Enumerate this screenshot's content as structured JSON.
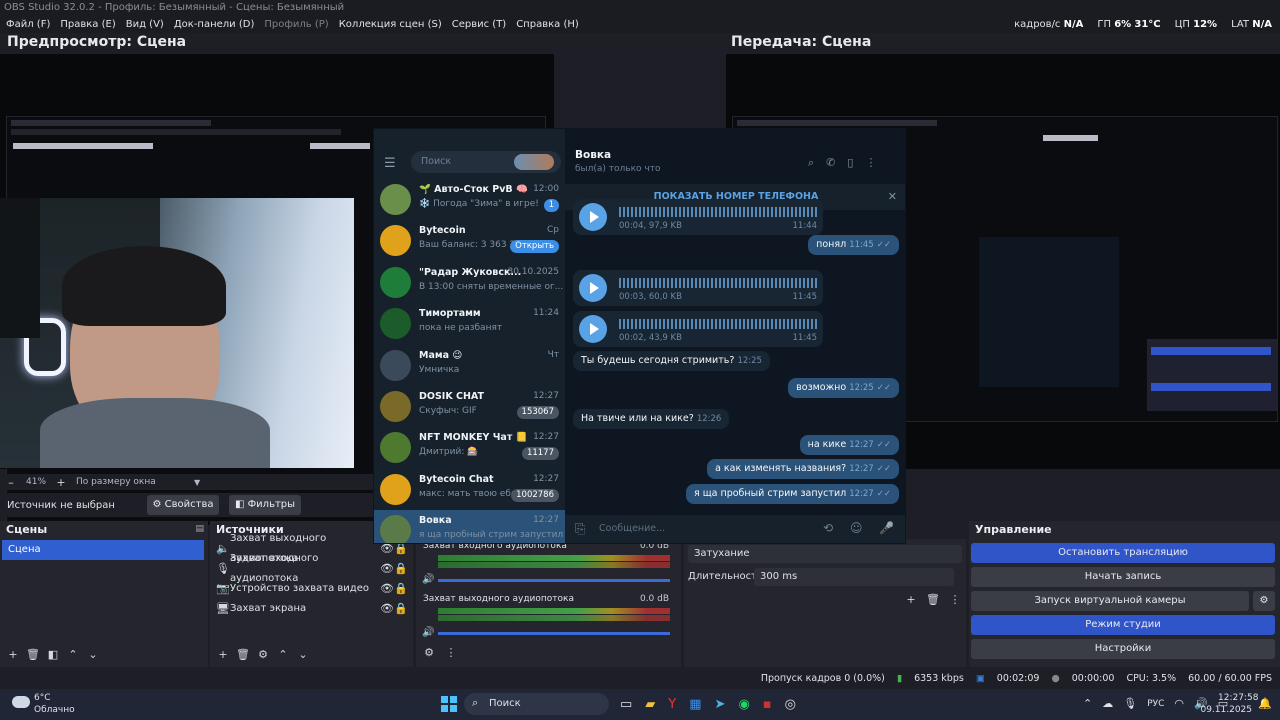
{
  "window_title": "OBS Studio 32.0.2 - Профиль: Безымянный - Сцены: Безымянный",
  "menu": [
    {
      "label": "Файл (F)",
      "disabled": false
    },
    {
      "label": "Правка (E)",
      "disabled": false
    },
    {
      "label": "Вид (V)",
      "disabled": false
    },
    {
      "label": "Док-панели (D)",
      "disabled": false
    },
    {
      "label": "Профиль (P)",
      "disabled": true
    },
    {
      "label": "Коллекция сцен (S)",
      "disabled": false
    },
    {
      "label": "Сервис (T)",
      "disabled": false
    },
    {
      "label": "Справка (H)",
      "disabled": false
    }
  ],
  "stats": {
    "fps_label": "кадров/с",
    "fps_value": "N/A",
    "gpu_label": "ГП",
    "gpu_value": "6%",
    "gpu_temp": "31°C",
    "cpu_label": "ЦП",
    "cpu_value": "12%",
    "lat_label": "LAT",
    "lat_value": "N/A"
  },
  "preview_title": "Предпросмотр: Сцена",
  "program_title": "Передача: Сцена",
  "zoom": {
    "value": "41%",
    "fit": "По размеру окна"
  },
  "source_bar": {
    "no_source": "Источник не выбран",
    "properties": "Свойства",
    "filters": "Фильтры"
  },
  "scenes": {
    "title": "Сцены",
    "items": [
      "Сцена"
    ]
  },
  "sources": {
    "title": "Источники",
    "items": [
      {
        "name": "Захват выходного аудиопотока",
        "icon": "speaker-icon"
      },
      {
        "name": "Захват входного аудиопотока",
        "icon": "mic-icon"
      },
      {
        "name": "Устройство захвата видео",
        "icon": "camera-icon"
      },
      {
        "name": "Захват экрана",
        "icon": "monitor-icon"
      }
    ]
  },
  "mixer": {
    "channels": [
      {
        "name": "Захват входного аудиопотока",
        "db": "0.0 dB",
        "volume": 0.97
      },
      {
        "name": "Захват выходного аудиопотока",
        "db": "0.0 dB",
        "volume": 0.97
      }
    ],
    "scale": [
      "-60",
      "-55",
      "-50",
      "-45",
      "-40",
      "-35",
      "-30",
      "-25",
      "-20",
      "-15",
      "-10",
      "-5",
      "0"
    ]
  },
  "transitions": {
    "type": "Затухание",
    "duration_label": "Длительность",
    "duration_value": "300 ms"
  },
  "controls": {
    "title": "Управление",
    "stop_stream": "Остановить трансляцию",
    "start_record": "Начать запись",
    "virtual_cam": "Запуск виртуальной камеры",
    "studio_mode": "Режим студии",
    "settings": "Настройки"
  },
  "statusbar": {
    "dropped": "Пропуск кадров 0 (0.0%)",
    "bitrate": "6353 kbps",
    "stream_time": "00:02:09",
    "rec_time": "00:00:00",
    "cpu": "CPU: 3.5%",
    "fps": "60.00 / 60.00 FPS"
  },
  "telegram": {
    "search_placeholder": "Поиск",
    "chats": [
      {
        "name": "🌱 Авто-Сток PvB 🧠",
        "preview": "❄️ Погода \"Зима\" в игре!",
        "time": "12:00",
        "badge": "1",
        "avatar": "#6a8f4a"
      },
      {
        "name": "Bytecoin",
        "preview": "Ваш баланс: 3 363 2...",
        "time": "Ср",
        "badge": "Открыть",
        "avatar": "#e0a21a"
      },
      {
        "name": "\"Радар Жуковск...",
        "preview": "В 13:00 сняты временные ог...",
        "time": "30.10.2025",
        "badge": "",
        "avatar": "#1f7d3a"
      },
      {
        "name": "Тимортамм",
        "preview": "пока не разбанят",
        "time": "11:24",
        "badge": "",
        "avatar": "#1c5c2a"
      },
      {
        "name": "Мама 😉",
        "preview": "Умничка",
        "time": "Чт",
        "badge": "",
        "avatar": "#3b4a5a"
      },
      {
        "name": "DOSIK CHAT",
        "preview": "Скуфыч: GIF",
        "time": "12:27",
        "badge": "153067",
        "avatar": "#7a6a2a"
      },
      {
        "name": "NFT MONKEY Чат 📒",
        "preview": "Дмитрий: 🎰",
        "time": "12:27",
        "badge": "11177",
        "avatar": "#4d7a2e"
      },
      {
        "name": "Bytecoin Chat",
        "preview": "макс: мать твою ебал",
        "time": "12:27",
        "badge": "1002786",
        "avatar": "#e0a21a"
      },
      {
        "name": "Вовка",
        "preview": "я ща пробный стрим запустил",
        "time": "12:27",
        "badge": "",
        "avatar": "#5b7a4a"
      }
    ],
    "header_name": "Вовка",
    "header_status": "был(а) только что",
    "show_phone": "ПОКАЗАТЬ НОМЕР ТЕЛЕФОНА",
    "messages": [
      {
        "dir": "in",
        "voice": true,
        "meta": "00:04, 97,9 KB",
        "time": "11:44"
      },
      {
        "dir": "out",
        "text": "понял",
        "time": "11:45"
      },
      {
        "dir": "in",
        "voice": true,
        "meta": "00:03, 60,0 KB",
        "time": "11:45"
      },
      {
        "dir": "in",
        "voice": true,
        "meta": "00:02, 43,9 KB",
        "time": "11:45"
      },
      {
        "dir": "in",
        "text": "Ты будешь сегодня стримить?",
        "time": "12:25"
      },
      {
        "dir": "out",
        "text": "возможно",
        "time": "12:25"
      },
      {
        "dir": "in",
        "text": "На твиче или на кике?",
        "time": "12:26"
      },
      {
        "dir": "out",
        "text": "на кике",
        "time": "12:27"
      },
      {
        "dir": "out",
        "text": "а как изменять названия?",
        "time": "12:27"
      },
      {
        "dir": "out",
        "text": "я ща пробный стрим запустил",
        "time": "12:27"
      }
    ],
    "input_placeholder": "Сообщение..."
  },
  "taskbar": {
    "weather_temp": "6°C",
    "weather_text": "Облачно",
    "search": "Поиск",
    "lang": "РУС",
    "time": "12:27:58",
    "date": "09.11.2025"
  },
  "colors": {
    "accent": "#2f55c8",
    "telegram_bg": "#0e1621",
    "telegram_out": "#2b5278"
  }
}
